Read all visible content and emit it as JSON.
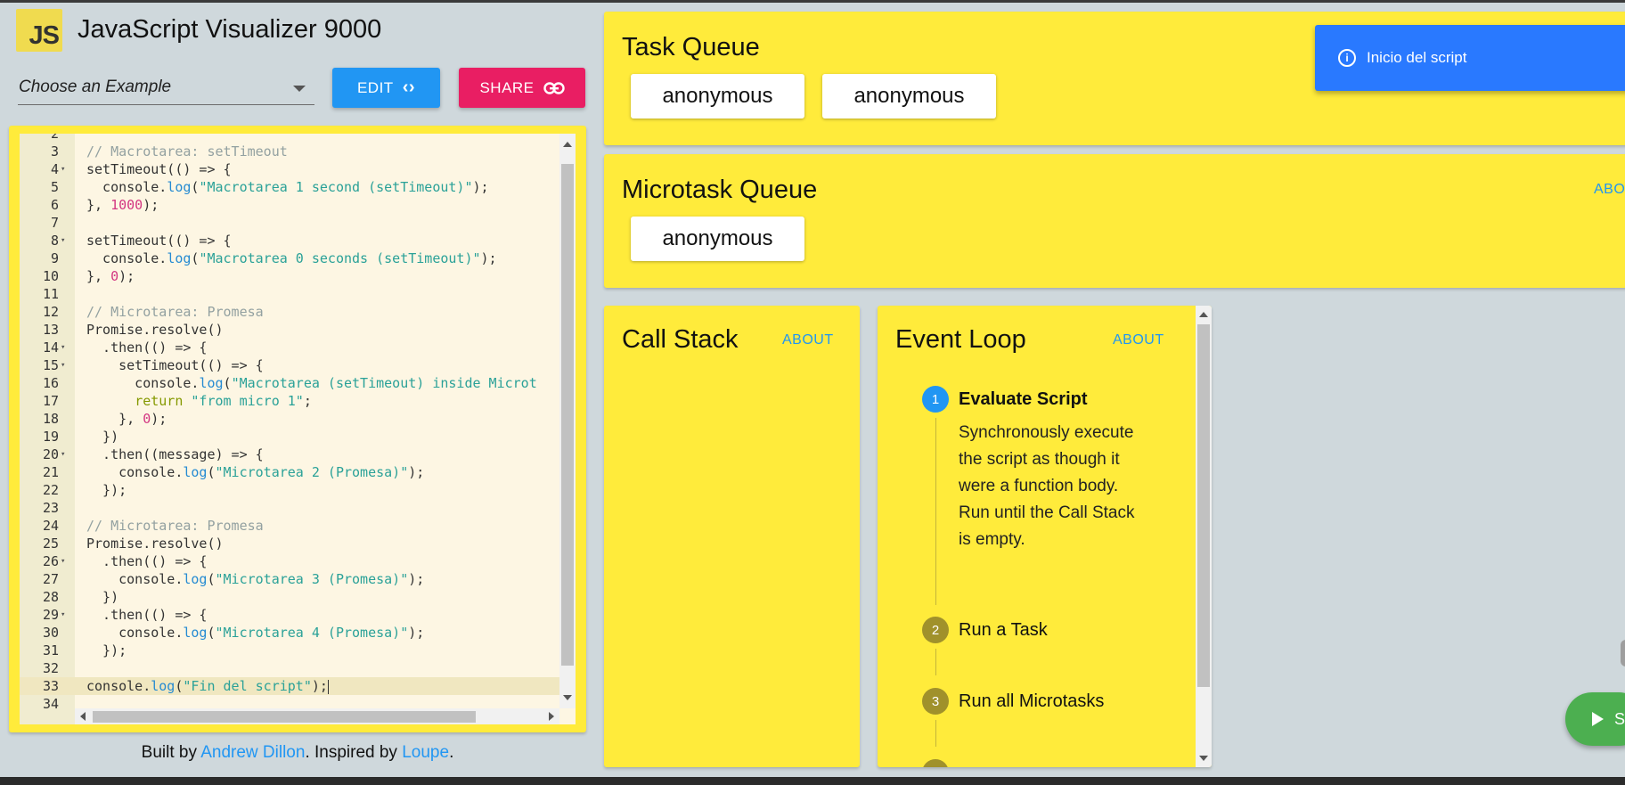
{
  "header": {
    "logo_text": "JS",
    "title": "JavaScript Visualizer 9000"
  },
  "controls": {
    "example_placeholder": "Choose an Example",
    "edit_label": "EDIT",
    "edit_icon": "code-icon",
    "share_label": "SHARE",
    "share_icon": "link-icon"
  },
  "editor": {
    "lines": [
      {
        "n": "2",
        "fold": false,
        "segments": []
      },
      {
        "n": "3",
        "fold": false,
        "segments": [
          {
            "t": "// Macrotarea: setTimeout",
            "c": "c-com"
          }
        ]
      },
      {
        "n": "4",
        "fold": true,
        "segments": [
          {
            "t": "setTimeout(() => {",
            "c": ""
          }
        ]
      },
      {
        "n": "5",
        "fold": false,
        "segments": [
          {
            "t": "  console.",
            "c": ""
          },
          {
            "t": "log",
            "c": "c-fn"
          },
          {
            "t": "(",
            "c": ""
          },
          {
            "t": "\"Macrotarea 1 second (setTimeout)\"",
            "c": "c-str"
          },
          {
            "t": ");",
            "c": ""
          }
        ]
      },
      {
        "n": "6",
        "fold": false,
        "segments": [
          {
            "t": "}, ",
            "c": ""
          },
          {
            "t": "1000",
            "c": "c-num"
          },
          {
            "t": ");",
            "c": ""
          }
        ]
      },
      {
        "n": "7",
        "fold": false,
        "segments": []
      },
      {
        "n": "8",
        "fold": true,
        "segments": [
          {
            "t": "setTimeout(() => {",
            "c": ""
          }
        ]
      },
      {
        "n": "9",
        "fold": false,
        "segments": [
          {
            "t": "  console.",
            "c": ""
          },
          {
            "t": "log",
            "c": "c-fn"
          },
          {
            "t": "(",
            "c": ""
          },
          {
            "t": "\"Macrotarea 0 seconds (setTimeout)\"",
            "c": "c-str"
          },
          {
            "t": ");",
            "c": ""
          }
        ]
      },
      {
        "n": "10",
        "fold": false,
        "segments": [
          {
            "t": "}, ",
            "c": ""
          },
          {
            "t": "0",
            "c": "c-num"
          },
          {
            "t": ");",
            "c": ""
          }
        ]
      },
      {
        "n": "11",
        "fold": false,
        "segments": []
      },
      {
        "n": "12",
        "fold": false,
        "segments": [
          {
            "t": "// Microtarea: Promesa",
            "c": "c-com"
          }
        ]
      },
      {
        "n": "13",
        "fold": false,
        "segments": [
          {
            "t": "Promise.resolve()",
            "c": ""
          }
        ]
      },
      {
        "n": "14",
        "fold": true,
        "segments": [
          {
            "t": "  .then(() => {",
            "c": ""
          }
        ]
      },
      {
        "n": "15",
        "fold": true,
        "segments": [
          {
            "t": "    setTimeout(() => {",
            "c": ""
          }
        ]
      },
      {
        "n": "16",
        "fold": false,
        "segments": [
          {
            "t": "      console.",
            "c": ""
          },
          {
            "t": "log",
            "c": "c-fn"
          },
          {
            "t": "(",
            "c": ""
          },
          {
            "t": "\"Macrotarea (setTimeout) inside Microt",
            "c": "c-str"
          }
        ]
      },
      {
        "n": "17",
        "fold": false,
        "segments": [
          {
            "t": "      ",
            "c": ""
          },
          {
            "t": "return",
            "c": "c-kw"
          },
          {
            "t": " ",
            "c": ""
          },
          {
            "t": "\"from micro 1\"",
            "c": "c-str"
          },
          {
            "t": ";",
            "c": ""
          }
        ]
      },
      {
        "n": "18",
        "fold": false,
        "segments": [
          {
            "t": "    }, ",
            "c": ""
          },
          {
            "t": "0",
            "c": "c-num"
          },
          {
            "t": ");",
            "c": ""
          }
        ]
      },
      {
        "n": "19",
        "fold": false,
        "segments": [
          {
            "t": "  })",
            "c": ""
          }
        ]
      },
      {
        "n": "20",
        "fold": true,
        "segments": [
          {
            "t": "  .then((message) => {",
            "c": ""
          }
        ]
      },
      {
        "n": "21",
        "fold": false,
        "segments": [
          {
            "t": "    console.",
            "c": ""
          },
          {
            "t": "log",
            "c": "c-fn"
          },
          {
            "t": "(",
            "c": ""
          },
          {
            "t": "\"Microtarea 2 (Promesa)\"",
            "c": "c-str"
          },
          {
            "t": ");",
            "c": ""
          }
        ]
      },
      {
        "n": "22",
        "fold": false,
        "segments": [
          {
            "t": "  });",
            "c": ""
          }
        ]
      },
      {
        "n": "23",
        "fold": false,
        "segments": []
      },
      {
        "n": "24",
        "fold": false,
        "segments": [
          {
            "t": "// Microtarea: Promesa",
            "c": "c-com"
          }
        ]
      },
      {
        "n": "25",
        "fold": false,
        "segments": [
          {
            "t": "Promise.resolve()",
            "c": ""
          }
        ]
      },
      {
        "n": "26",
        "fold": true,
        "segments": [
          {
            "t": "  .then(() => {",
            "c": ""
          }
        ]
      },
      {
        "n": "27",
        "fold": false,
        "segments": [
          {
            "t": "    console.",
            "c": ""
          },
          {
            "t": "log",
            "c": "c-fn"
          },
          {
            "t": "(",
            "c": ""
          },
          {
            "t": "\"Microtarea 3 (Promesa)\"",
            "c": "c-str"
          },
          {
            "t": ");",
            "c": ""
          }
        ]
      },
      {
        "n": "28",
        "fold": false,
        "segments": [
          {
            "t": "  })",
            "c": ""
          }
        ]
      },
      {
        "n": "29",
        "fold": true,
        "segments": [
          {
            "t": "  .then(() => {",
            "c": ""
          }
        ]
      },
      {
        "n": "30",
        "fold": false,
        "segments": [
          {
            "t": "    console.",
            "c": ""
          },
          {
            "t": "log",
            "c": "c-fn"
          },
          {
            "t": "(",
            "c": ""
          },
          {
            "t": "\"Microtarea 4 (Promesa)\"",
            "c": "c-str"
          },
          {
            "t": ");",
            "c": ""
          }
        ]
      },
      {
        "n": "31",
        "fold": false,
        "segments": [
          {
            "t": "  });",
            "c": ""
          }
        ]
      },
      {
        "n": "32",
        "fold": false,
        "segments": []
      },
      {
        "n": "33",
        "fold": false,
        "active": true,
        "segments": [
          {
            "t": "console.",
            "c": ""
          },
          {
            "t": "log",
            "c": "c-fn"
          },
          {
            "t": "(",
            "c": ""
          },
          {
            "t": "\"Fin del script\"",
            "c": "c-str"
          },
          {
            "t": ");",
            "c": ""
          }
        ]
      },
      {
        "n": "34",
        "fold": false,
        "segments": []
      }
    ]
  },
  "credits": {
    "prefix": "Built by ",
    "author": "Andrew Dillon",
    "middle": ". Inspired by ",
    "inspiration": "Loupe",
    "suffix": "."
  },
  "task_queue": {
    "title": "Task Queue",
    "items": [
      "anonymous",
      "anonymous"
    ]
  },
  "microtask_queue": {
    "title": "Microtask Queue",
    "about_label": "ABO",
    "items": [
      "anonymous"
    ]
  },
  "call_stack": {
    "title": "Call Stack",
    "about_label": "ABOUT"
  },
  "event_loop": {
    "title": "Event Loop",
    "about_label": "ABOUT",
    "steps": [
      {
        "number": "1",
        "title": "Evaluate Script",
        "active": true,
        "description": "Synchronously execute the script as though it were a function body. Run until the Call Stack is empty."
      },
      {
        "number": "2",
        "title": "Run a Task",
        "active": false
      },
      {
        "number": "3",
        "title": "Run all Microtasks",
        "active": false
      }
    ]
  },
  "toast": {
    "icon": "info-icon",
    "message": "Inicio del script"
  },
  "fab": {
    "icon": "play-icon",
    "label": "S"
  },
  "colors": {
    "panel": "#ffeb3b",
    "background": "#cfd8dc",
    "edit": "#2196f3",
    "share": "#e91e63",
    "toast": "#2979ff",
    "start": "#4caf50",
    "step_active": "#2196f3",
    "step_inactive": "#a0912b"
  }
}
